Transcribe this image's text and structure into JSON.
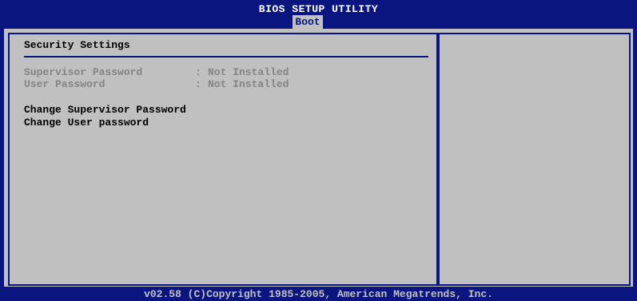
{
  "header": {
    "title": "BIOS SETUP UTILITY",
    "active_tab": "Boot"
  },
  "main": {
    "section_title": "Security Settings",
    "status_rows": [
      {
        "label": "Supervisor Password",
        "value": "Not Installed"
      },
      {
        "label": "User Password",
        "value": "Not Installed"
      }
    ],
    "status_separator": ":",
    "actions": [
      {
        "label": "Change Supervisor Password"
      },
      {
        "label": "Change User password"
      }
    ]
  },
  "help_panel": {
    "text": ""
  },
  "footer": {
    "copyright": "v02.58 (C)Copyright 1985-2005, American Megatrends, Inc."
  },
  "colors": {
    "background_blue": "#0a1580",
    "panel_gray": "#c0c0c0",
    "disabled_text": "#848484",
    "active_text": "#000000"
  }
}
